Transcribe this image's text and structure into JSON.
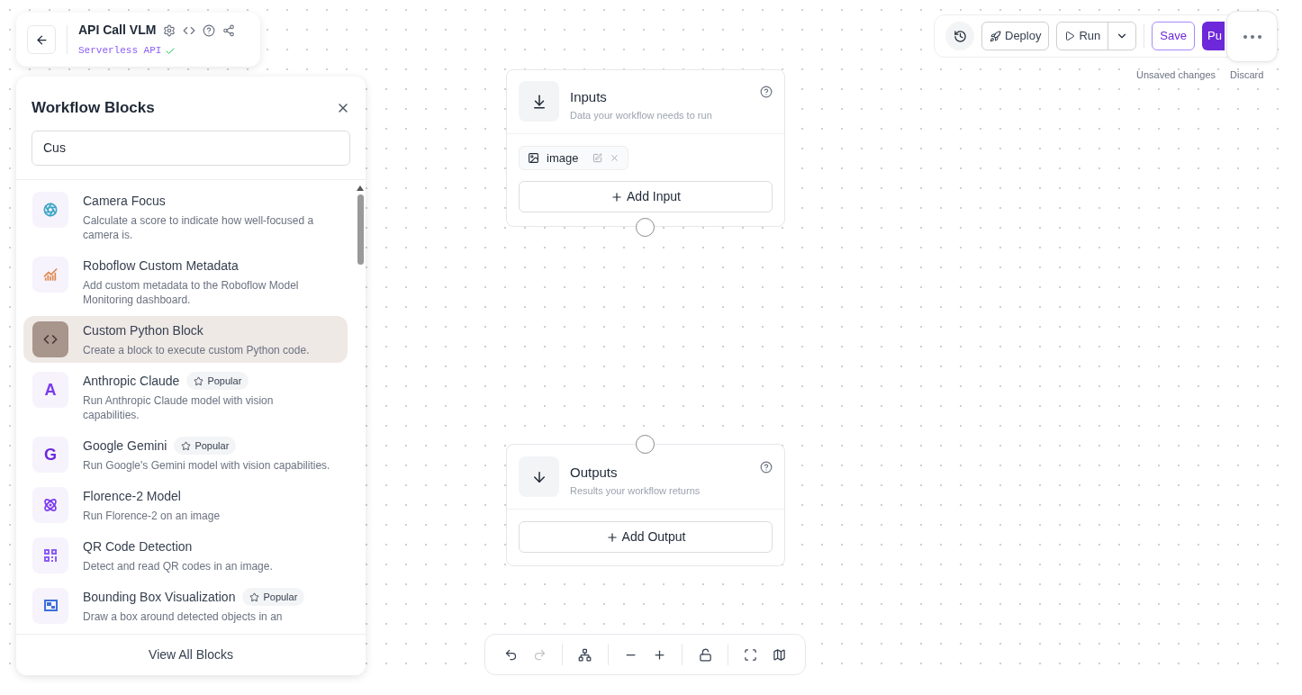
{
  "header": {
    "title": "API Call VLM",
    "subtitle": "Serverless API",
    "verified": true
  },
  "blocks_panel": {
    "title": "Workflow Blocks",
    "search": {
      "value": "Cus"
    },
    "items": [
      {
        "name": "Camera Focus",
        "description": "Calculate a score to indicate how well-focused a camera is.",
        "kind": "aperture",
        "color": "#3fa7c4",
        "selected": false
      },
      {
        "name": "Roboflow Custom Metadata",
        "description": "Add custom metadata to the Roboflow Model Monitoring dashboard.",
        "kind": "chart",
        "color": "#e08a4f",
        "selected": false
      },
      {
        "name": "Custom Python Block",
        "description": "Create a block to execute custom Python code.",
        "kind": "code",
        "color": "#4a3a33",
        "selected": true
      },
      {
        "name": "Anthropic Claude",
        "badge": "Popular",
        "description": "Run Anthropic Claude model with vision capabilities.",
        "kind": "glyph",
        "glyph": "A",
        "color": "#7c3aed",
        "selected": false
      },
      {
        "name": "Google Gemini",
        "badge": "Popular",
        "description": "Run Google's Gemini model with vision capabilities.",
        "kind": "glyph",
        "glyph": "G",
        "color": "#6d28d9",
        "selected": false
      },
      {
        "name": "Florence-2 Model",
        "description": "Run Florence-2 on an image",
        "kind": "atom",
        "color": "#7c3aed",
        "selected": false
      },
      {
        "name": "QR Code Detection",
        "description": "Detect and read QR codes in an image.",
        "kind": "qr",
        "color": "#8b5cf6",
        "selected": false
      },
      {
        "name": "Bounding Box Visualization",
        "badge": "Popular",
        "description": "Draw a box around detected objects in an",
        "kind": "box",
        "color": "#3b6fd9",
        "selected": false
      }
    ],
    "footer": "View All Blocks"
  },
  "toolbar": {
    "deploy": "Deploy",
    "run": "Run",
    "save": "Save",
    "publish": "Pu",
    "status": "Unsaved changes",
    "discard": "Discard"
  },
  "inputs": {
    "title": "Inputs",
    "subtitle": "Data your workflow needs to run",
    "params": [
      {
        "name": "image"
      }
    ],
    "add": "Add Input"
  },
  "outputs": {
    "title": "Outputs",
    "subtitle": "Results your workflow returns",
    "add": "Add Output"
  }
}
